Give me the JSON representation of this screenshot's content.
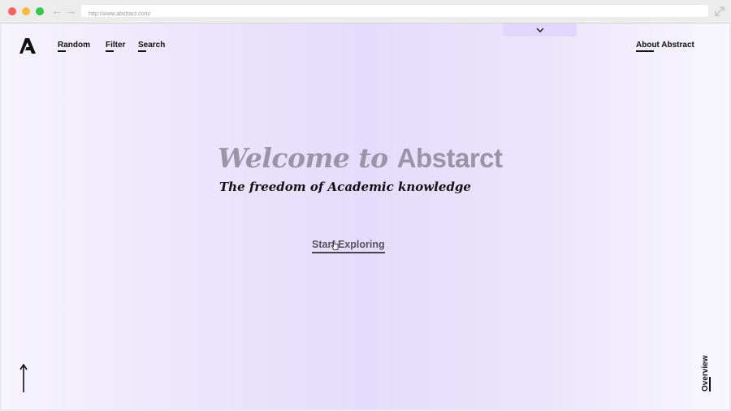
{
  "browser": {
    "url": "http://www.abstract.com/"
  },
  "icons": {
    "back": "arrow-left-icon",
    "forward": "arrow-right-icon",
    "expand": "expand-icon",
    "dropdown": "chevron-down-icon",
    "logo": "abstract-a-logo",
    "scroll_up": "arrow-up-icon",
    "cursor": "pointer-cursor-icon"
  },
  "colors": {
    "background_center": "#e4dcfc",
    "title_gray": "#9a95a6",
    "text_dark": "#111111"
  },
  "nav": {
    "items": [
      {
        "label": "Random"
      },
      {
        "label": "Filter"
      },
      {
        "label": "Search"
      }
    ],
    "about": "About Abstract"
  },
  "hero": {
    "title_lead": "Welcome to ",
    "title_brand": "Abstarct",
    "subtitle": "The freedom of Academic knowledge",
    "cta": "Start Exploring"
  },
  "side": {
    "overview": "Overview"
  }
}
